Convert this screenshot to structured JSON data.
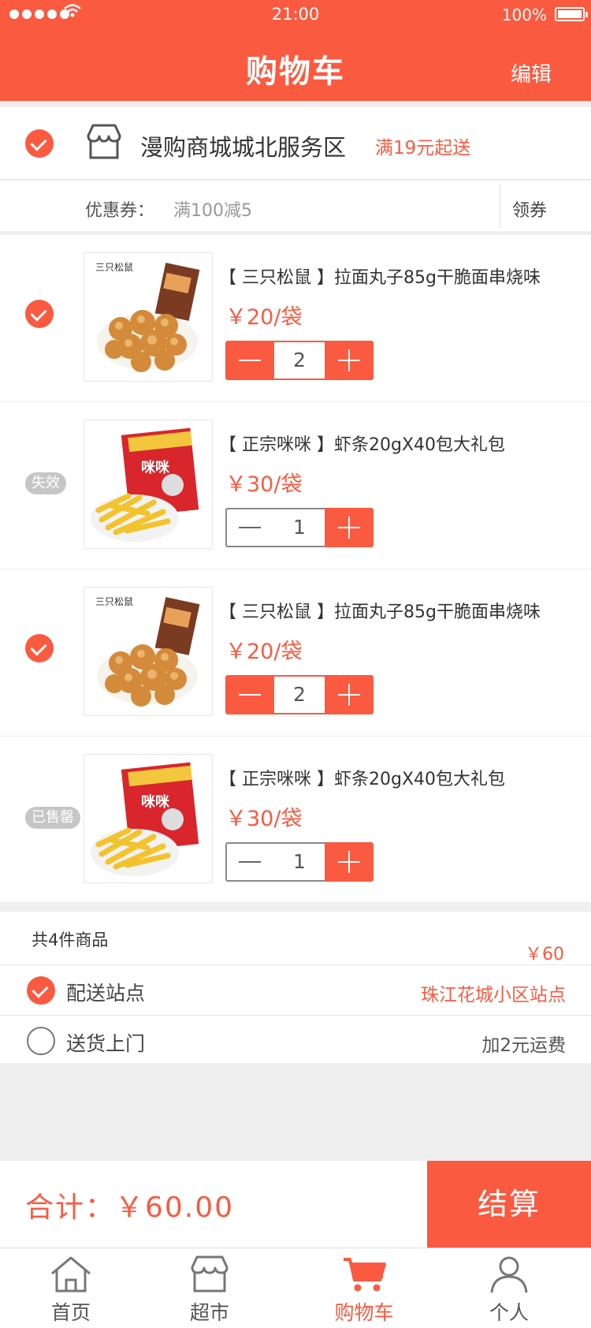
{
  "status_bar": {
    "time": "21:00",
    "battery": "100%"
  },
  "header": {
    "title": "购物车",
    "edit_label": "编辑"
  },
  "store": {
    "name": "漫购商城城北服务区",
    "min_order": "满19元起送"
  },
  "coupon": {
    "label": "优惠券：",
    "value": "满100减5",
    "button": "领券"
  },
  "items": [
    {
      "name": "【 三只松鼠 】拉面丸子85g干脆面串烧味",
      "price": "￥20/袋",
      "quantity": "2",
      "status": "checked"
    },
    {
      "name": "【 正宗咪咪 】虾条20gX40包大礼包",
      "price": "￥30/袋",
      "quantity": "1",
      "status": "失效"
    },
    {
      "name": "【 三只松鼠 】拉面丸子85g干脆面串烧味",
      "price": "￥20/袋",
      "quantity": "2",
      "status": "checked"
    },
    {
      "name": "【 正宗咪咪 】虾条20gX40包大礼包",
      "price": "￥30/袋",
      "quantity": "1",
      "status": "已售罄"
    }
  ],
  "summary": {
    "count": "共4件商品",
    "total": "￥60",
    "delivery_station_label": "配送站点",
    "delivery_station_value": "珠江花城小区站点",
    "home_delivery_label": "送货上门",
    "home_delivery_value": "加2元运费"
  },
  "checkout": {
    "total": "合计：￥60.00",
    "button": "结算"
  },
  "tabs": [
    {
      "label": "首页",
      "icon": "home-icon"
    },
    {
      "label": "超市",
      "icon": "store-icon"
    },
    {
      "label": "购物车",
      "icon": "cart-icon"
    },
    {
      "label": "个人",
      "icon": "person-icon"
    }
  ],
  "colors": {
    "accent": "#fa5a40",
    "badge": "#c6c6c6"
  }
}
